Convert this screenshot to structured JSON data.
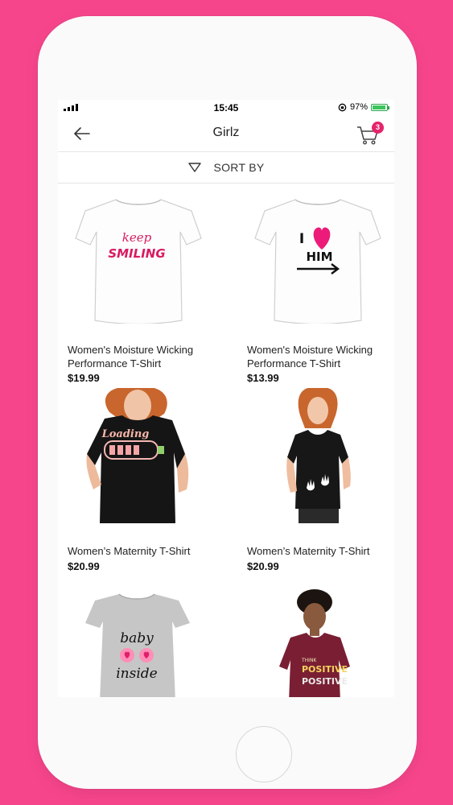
{
  "status": {
    "time": "15:45",
    "battery": "97%"
  },
  "nav": {
    "title": "Girlz",
    "cart_count": "3"
  },
  "sort": {
    "label": "SORT BY"
  },
  "products": [
    {
      "name": "Women's Moisture Wicking Performance T-Shirt",
      "price": "$19.99",
      "print_line1": "keep",
      "print_line2": "SMILING"
    },
    {
      "name": "Women's Moisture Wicking Performance T-Shirt",
      "price": "$13.99",
      "print_line1": "I",
      "print_line2": "HIM"
    },
    {
      "name": "Women’s Maternity T-Shirt",
      "price": "$20.99",
      "print_line1": "Loading"
    },
    {
      "name": "Women’s Maternity T-Shirt",
      "price": "$20.99"
    },
    {
      "print_line1": "baby",
      "print_line2": "inside"
    },
    {
      "print_line1": "THINK",
      "print_line2": "POSITIVE",
      "print_line3": "POSITIVE"
    }
  ],
  "colors": {
    "background": "#f7458c",
    "accent": "#e5246c"
  }
}
